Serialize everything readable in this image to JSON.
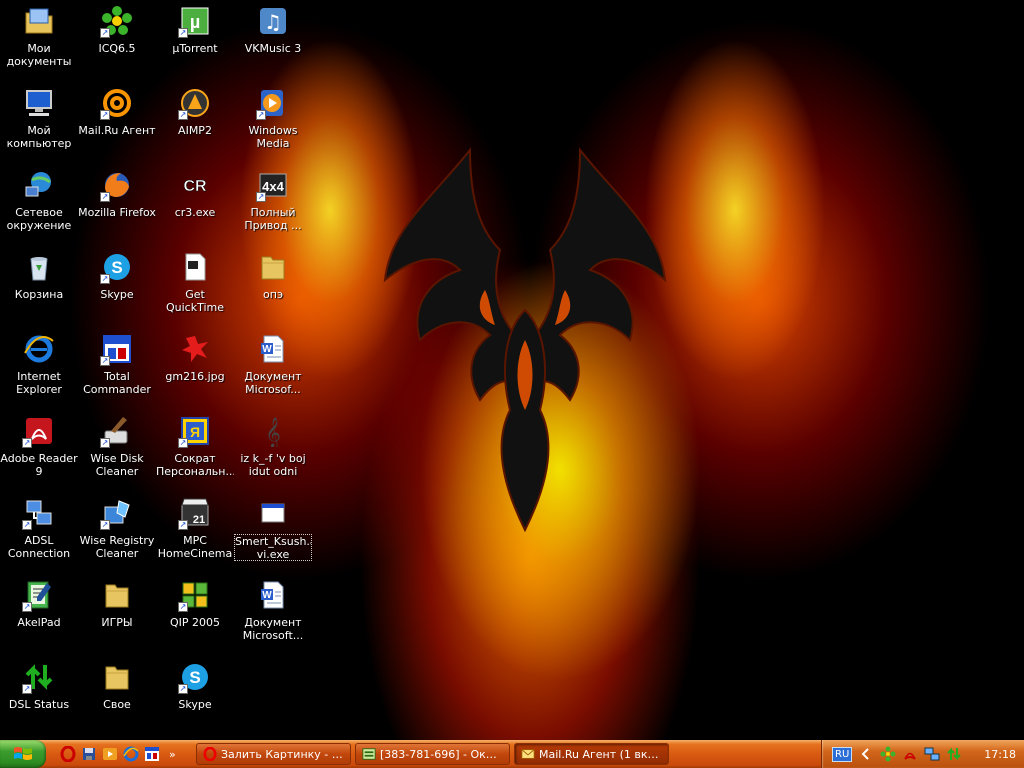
{
  "desktop": {
    "icons": [
      {
        "label": "Мои\nдокументы",
        "icon": "my-documents-folder-icon",
        "shortcut": false
      },
      {
        "label": "Мой\nкомпьютер",
        "icon": "my-computer-icon",
        "shortcut": false
      },
      {
        "label": "Сетевое\nокружение",
        "icon": "network-places-icon",
        "shortcut": false
      },
      {
        "label": "Корзина",
        "icon": "recycle-bin-icon",
        "shortcut": false
      },
      {
        "label": "Internet\nExplorer",
        "icon": "internet-explorer-icon",
        "shortcut": false
      },
      {
        "label": "Adobe Reader\n9",
        "icon": "adobe-reader-icon",
        "shortcut": true
      },
      {
        "label": "ADSL\nConnection",
        "icon": "adsl-connection-icon",
        "shortcut": true
      },
      {
        "label": "AkelPad",
        "icon": "akelpad-icon",
        "shortcut": true
      },
      {
        "label": "DSL Status",
        "icon": "dsl-status-icon",
        "shortcut": true
      },
      {
        "label": "ICQ6.5",
        "icon": "icq-flower-icon",
        "shortcut": true
      },
      {
        "label": "Mail.Ru Агент",
        "icon": "mailru-agent-icon",
        "shortcut": true
      },
      {
        "label": "Mozilla Firefox",
        "icon": "firefox-icon",
        "shortcut": true
      },
      {
        "label": "Skype",
        "icon": "skype-icon",
        "shortcut": true
      },
      {
        "label": "Total\nCommander",
        "icon": "total-commander-icon",
        "shortcut": true
      },
      {
        "label": "Wise Disk\nCleaner",
        "icon": "wise-disk-cleaner-icon",
        "shortcut": true
      },
      {
        "label": "Wise Registry\nCleaner",
        "icon": "wise-registry-cleaner-icon",
        "shortcut": true
      },
      {
        "label": "ИГРЫ",
        "icon": "folder-icon",
        "shortcut": false
      },
      {
        "label": "Свое",
        "icon": "folder-icon",
        "shortcut": false
      },
      {
        "label": "µTorrent",
        "icon": "utorrent-icon",
        "shortcut": true
      },
      {
        "label": "AIMP2",
        "icon": "aimp-icon",
        "shortcut": true
      },
      {
        "label": "cr3.exe",
        "icon": "cr3-icon",
        "shortcut": false
      },
      {
        "label": "Get QuickTime\nPro.mov",
        "icon": "quicktime-file-icon",
        "shortcut": false
      },
      {
        "label": "gm216.jpg",
        "icon": "image-splash-icon",
        "shortcut": false
      },
      {
        "label": "Сократ\nПерсональн...",
        "icon": "sokrat-dictionary-icon",
        "shortcut": true
      },
      {
        "label": "MPC\nHomeCinema",
        "icon": "mpc-homecinema-icon",
        "shortcut": true
      },
      {
        "label": "QIP 2005",
        "icon": "qip-icon",
        "shortcut": true
      },
      {
        "label": "Skype",
        "icon": "skype-icon",
        "shortcut": true
      },
      {
        "label": "VKMusic 3",
        "icon": "vkmusic-icon",
        "shortcut": false
      },
      {
        "label": "Windows Media\nPlayer",
        "icon": "windows-media-player-icon",
        "shortcut": true
      },
      {
        "label": "Полный\nПривод ...",
        "icon": "4x4-game-icon",
        "shortcut": true
      },
      {
        "label": "опэ",
        "icon": "folder-icon",
        "shortcut": false
      },
      {
        "label": "Документ\nMicrosof...",
        "icon": "word-document-icon",
        "shortcut": false
      },
      {
        "label": "iz k_-f 'v boj\nidut odni sta...",
        "icon": "music-note-icon",
        "shortcut": false
      },
      {
        "label": "Smert_Ksush.a\nvi.exe",
        "icon": "exe-file-icon",
        "shortcut": false,
        "selected": true
      },
      {
        "label": "Документ\nMicrosoft...",
        "icon": "word-document-icon",
        "shortcut": false
      }
    ]
  },
  "taskbar": {
    "start_icon": "windows-logo-icon",
    "quick_launch": [
      {
        "icon": "opera-icon"
      },
      {
        "icon": "save-disk-icon"
      },
      {
        "icon": "media-player-icon"
      },
      {
        "icon": "internet-explorer-icon"
      },
      {
        "icon": "tc-icon"
      }
    ],
    "more_label": "»",
    "tasks": [
      {
        "label": "Залить Картинку - З...",
        "icon": "opera-icon",
        "active": false
      },
      {
        "label": "[383-781-696] - Окно...",
        "icon": "qip-window-icon",
        "active": false
      },
      {
        "label": "Mail.Ru Агент (1 вкла...",
        "icon": "mail-envelope-icon",
        "active": true
      }
    ],
    "tray": {
      "language": "RU",
      "clock": "17:18",
      "icons": [
        "chevron-left-icon",
        "icq-flower-icon",
        "adobe-icon",
        "network-computers-icon",
        "network-arrows-icon"
      ]
    }
  },
  "colors": {
    "taskbar": "#d95a12",
    "start_button": "#3c9d2e",
    "desktop_bg": "#000000",
    "flame_yellow": "#ffd400",
    "flame_red": "#d00000"
  }
}
